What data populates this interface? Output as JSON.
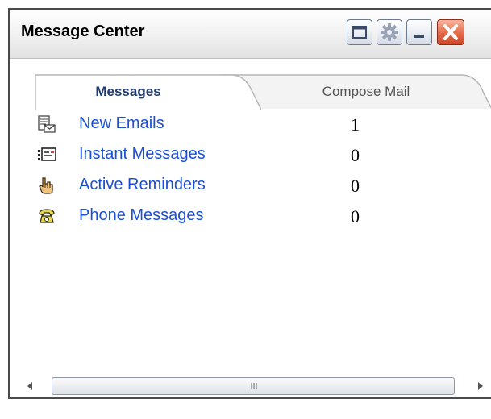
{
  "window": {
    "title": "Message Center",
    "buttons": [
      "maximize-icon",
      "gear-icon",
      "minimize-icon",
      "close-icon"
    ]
  },
  "tabs": [
    {
      "label": "Messages",
      "active": true
    },
    {
      "label": "Compose Mail",
      "active": false
    }
  ],
  "items": [
    {
      "label": "New Emails",
      "count": "1",
      "icon": "email-document-icon"
    },
    {
      "label": "Instant Messages",
      "count": "0",
      "icon": "instant-message-card-icon"
    },
    {
      "label": "Active Reminders",
      "count": "0",
      "icon": "hand-pointer-icon"
    },
    {
      "label": "Phone Messages",
      "count": "0",
      "icon": "telephone-icon"
    }
  ],
  "colors": {
    "link": "#1a4fd6",
    "close_button": "#e56a48"
  }
}
